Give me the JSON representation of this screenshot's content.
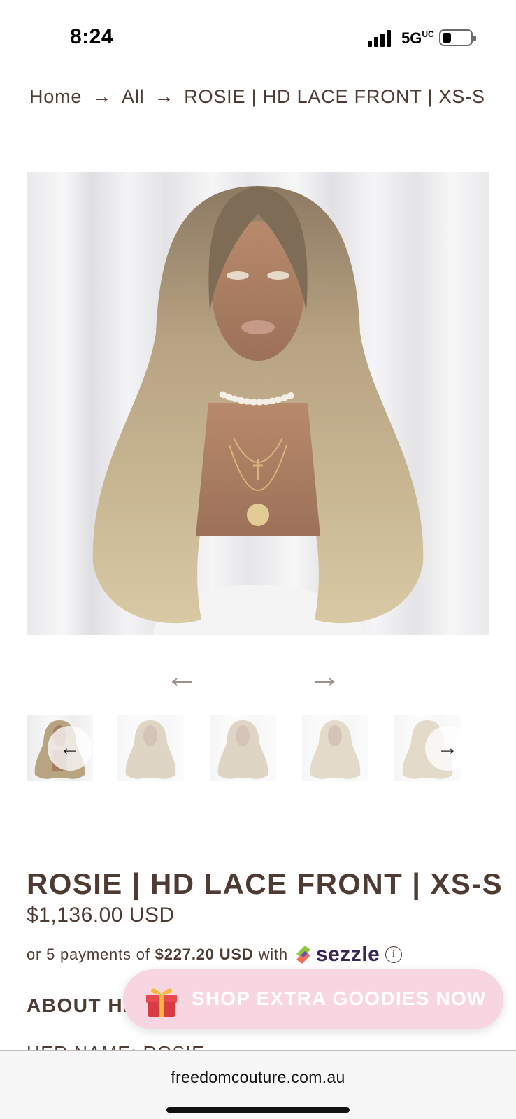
{
  "status": {
    "time": "8:24",
    "network": "5G UC",
    "network_label": "5G",
    "network_sub": "UC"
  },
  "breadcrumb": {
    "items": [
      "Home",
      "All",
      "ROSIE | HD LACE FRONT | XS-S"
    ],
    "separator": "→"
  },
  "gallery": {
    "prev_arrow": "←",
    "next_arrow": "→",
    "thumb_prev": "←",
    "thumb_next": "→"
  },
  "product": {
    "title": "ROSIE | HD LACE FRONT | XS-S",
    "price": "$1,136.00 USD",
    "installments_prefix": "or 5 payments of",
    "installments_amount": "$227.20 USD",
    "installments_suffix": "with",
    "sezzle": "sezzle",
    "info": "i"
  },
  "about": {
    "heading": "ABOUT HER",
    "name_line": "HER NAME: ROSIE"
  },
  "cta": {
    "label": "SHOP EXTRA GOODIES NOW",
    "icon": "gift-icon"
  },
  "browser": {
    "url": "freedomcouture.com.au"
  },
  "colors": {
    "text": "#4e3c34",
    "cta_bg": "#f7d6e2",
    "sezzle": "#382757"
  }
}
